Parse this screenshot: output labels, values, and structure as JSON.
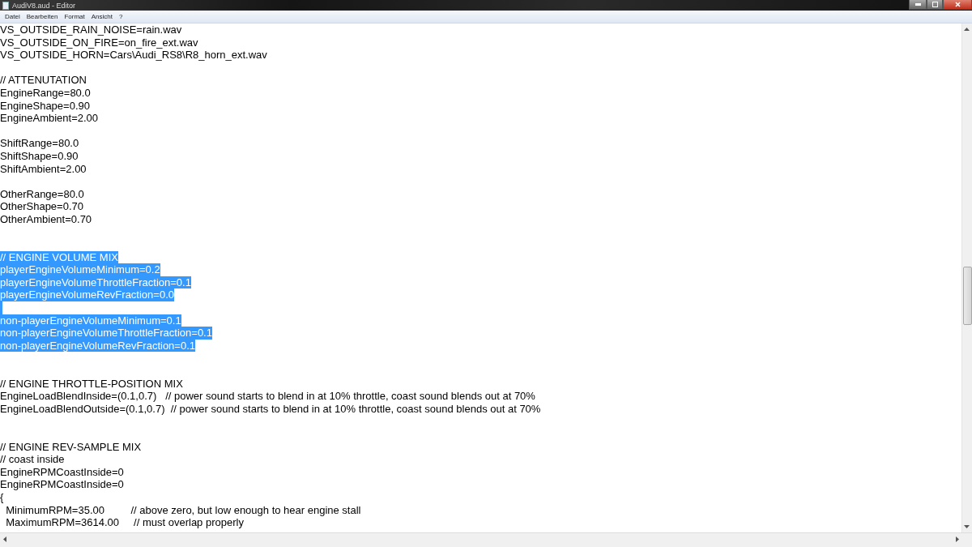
{
  "window": {
    "title": "AudiV8.aud - Editor"
  },
  "menu": [
    "Datei",
    "Bearbeiten",
    "Format",
    "Ansicht",
    "?"
  ],
  "lines": [
    {
      "kind": "text",
      "text": "VS_OUTSIDE_RAIN_NOISE=rain.wav",
      "selected": false
    },
    {
      "kind": "text",
      "text": "VS_OUTSIDE_ON_FIRE=on_fire_ext.wav",
      "selected": false
    },
    {
      "kind": "text",
      "text": "VS_OUTSIDE_HORN=Cars\\Audi_RS8\\R8_horn_ext.wav",
      "selected": false
    },
    {
      "kind": "blank",
      "selected": false
    },
    {
      "kind": "text",
      "text": "// ATTENUTATION",
      "selected": false
    },
    {
      "kind": "text",
      "text": "EngineRange=80.0",
      "selected": false
    },
    {
      "kind": "text",
      "text": "EngineShape=0.90",
      "selected": false
    },
    {
      "kind": "text",
      "text": "EngineAmbient=2.00",
      "selected": false
    },
    {
      "kind": "blank",
      "selected": false
    },
    {
      "kind": "text",
      "text": "ShiftRange=80.0",
      "selected": false
    },
    {
      "kind": "text",
      "text": "ShiftShape=0.90",
      "selected": false
    },
    {
      "kind": "text",
      "text": "ShiftAmbient=2.00",
      "selected": false
    },
    {
      "kind": "blank",
      "selected": false
    },
    {
      "kind": "text",
      "text": "OtherRange=80.0",
      "selected": false
    },
    {
      "kind": "text",
      "text": "OtherShape=0.70",
      "selected": false
    },
    {
      "kind": "text",
      "text": "OtherAmbient=0.70",
      "selected": false
    },
    {
      "kind": "blank",
      "selected": false
    },
    {
      "kind": "blank",
      "selected": false
    },
    {
      "kind": "text",
      "text": "// ENGINE VOLUME MIX",
      "selected": true
    },
    {
      "kind": "text",
      "text": "playerEngineVolumeMinimum=0.2",
      "selected": true
    },
    {
      "kind": "text",
      "text": "playerEngineVolumeThrottleFraction=0.1",
      "selected": true
    },
    {
      "kind": "text",
      "text": "playerEngineVolumeRevFraction=0.0",
      "selected": true
    },
    {
      "kind": "blank",
      "selected": true
    },
    {
      "kind": "text",
      "text": "non-playerEngineVolumeMinimum=0.1",
      "selected": true
    },
    {
      "kind": "text",
      "text": "non-playerEngineVolumeThrottleFraction=0.1",
      "selected": true
    },
    {
      "kind": "text",
      "text": "non-playerEngineVolumeRevFraction=0.1",
      "selected": true
    },
    {
      "kind": "blank",
      "selected": false
    },
    {
      "kind": "blank",
      "selected": false
    },
    {
      "kind": "text",
      "text": "// ENGINE THROTTLE-POSITION MIX",
      "selected": false
    },
    {
      "kind": "text",
      "text": "EngineLoadBlendInside=(0.1,0.7)   // power sound starts to blend in at 10% throttle, coast sound blends out at 70%",
      "selected": false
    },
    {
      "kind": "text",
      "text": "EngineLoadBlendOutside=(0.1,0.7)  // power sound starts to blend in at 10% throttle, coast sound blends out at 70%",
      "selected": false
    },
    {
      "kind": "blank",
      "selected": false
    },
    {
      "kind": "blank",
      "selected": false
    },
    {
      "kind": "text",
      "text": "// ENGINE REV-SAMPLE MIX",
      "selected": false
    },
    {
      "kind": "text",
      "text": "// coast inside",
      "selected": false
    },
    {
      "kind": "text",
      "text": "EngineRPMCoastInside=0",
      "selected": false
    },
    {
      "kind": "text",
      "text": "EngineRPMCoastInside=0",
      "selected": false
    },
    {
      "kind": "text",
      "text": "{",
      "selected": false
    },
    {
      "kind": "text",
      "text": "  MinimumRPM=35.00         // above zero, but low enough to hear engine stall",
      "selected": false
    },
    {
      "kind": "text",
      "text": "  MaximumRPM=3614.00     // must overlap properly",
      "selected": false
    }
  ]
}
